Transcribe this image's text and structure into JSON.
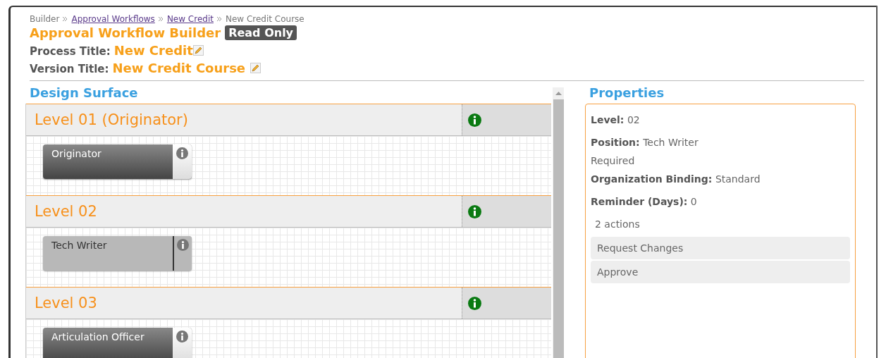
{
  "breadcrumb": [
    {
      "label": "Builder",
      "link": false
    },
    {
      "label": "Approval Workflows",
      "link": true
    },
    {
      "label": "New Credit",
      "link": true
    },
    {
      "label": "New Credit Course",
      "link": false
    }
  ],
  "title": "Approval Workflow Builder",
  "badge": "Read Only",
  "process_title": {
    "label": "Process Title:",
    "value": "New Credit"
  },
  "version_title": {
    "label": "Version Title:",
    "value": "New Credit Course"
  },
  "design_surface": {
    "heading": "Design Surface",
    "levels": [
      {
        "title": "Level 01 (Originator)",
        "positions": [
          {
            "name": "Originator",
            "selected": false
          }
        ]
      },
      {
        "title": "Level 02",
        "positions": [
          {
            "name": "Tech Writer",
            "selected": true
          }
        ]
      },
      {
        "title": "Level 03",
        "positions": [
          {
            "name": "Articulation Officer",
            "selected": false
          }
        ]
      }
    ]
  },
  "properties": {
    "heading": "Properties",
    "rows": [
      {
        "kind": "field",
        "label": "Level:",
        "value": "02"
      },
      {
        "kind": "field",
        "label": "Position:",
        "value": "Tech Writer"
      },
      {
        "kind": "flag",
        "value": "Required"
      },
      {
        "kind": "field",
        "label": "Organization Binding:",
        "value": "Standard"
      },
      {
        "kind": "field",
        "label": "Reminder (Days):",
        "value": "0"
      }
    ],
    "actions_count": "2 actions",
    "actions": [
      "Request Changes",
      "Approve"
    ]
  }
}
